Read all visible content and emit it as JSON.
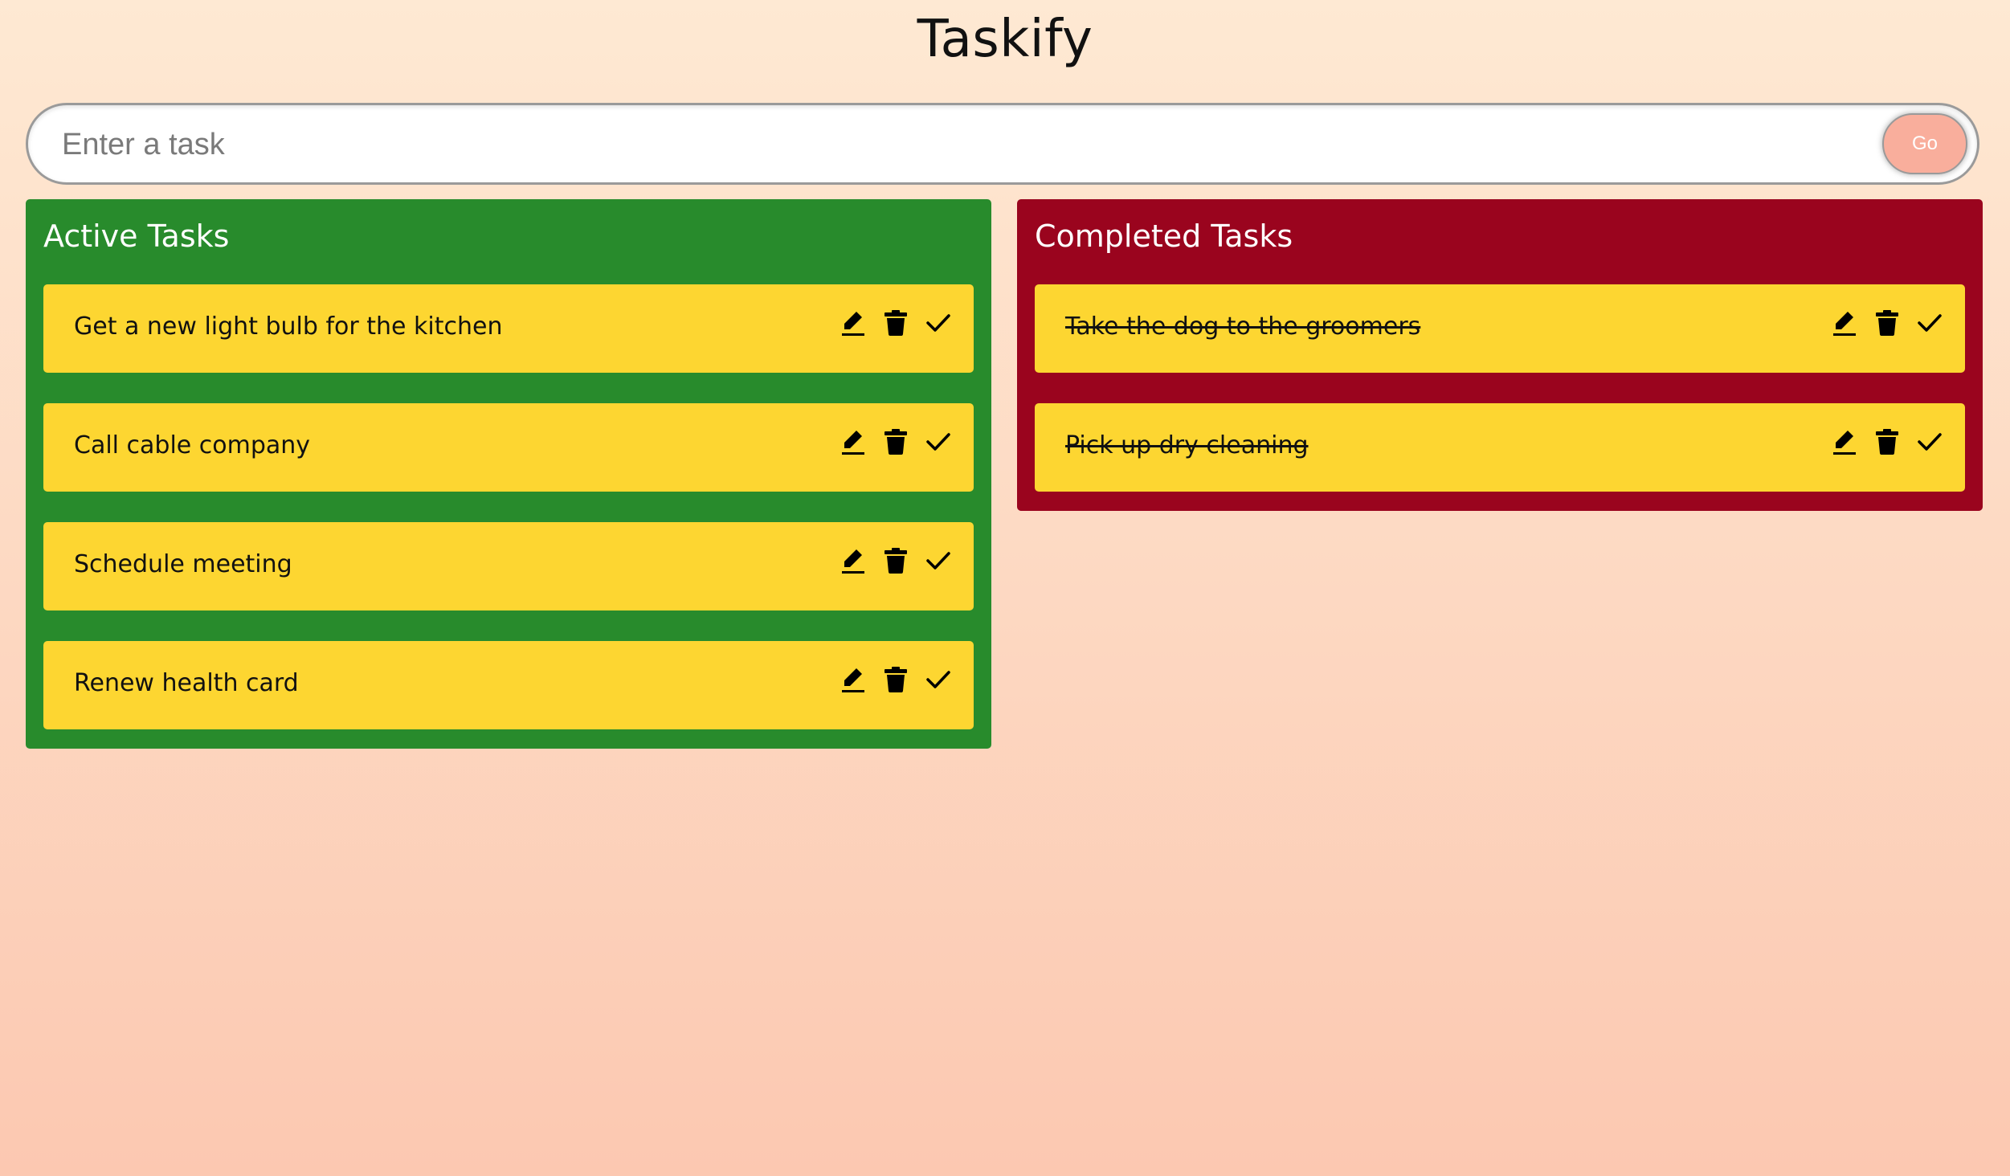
{
  "app": {
    "title": "Taskify"
  },
  "input": {
    "placeholder": "Enter a task",
    "value": "",
    "submit_label": "Go"
  },
  "active_panel": {
    "heading": "Active Tasks",
    "tasks": [
      "Get a new light bulb for the kitchen",
      "Call cable company",
      "Schedule meeting",
      "Renew health card"
    ]
  },
  "completed_panel": {
    "heading": "Completed Tasks",
    "tasks": [
      "Take the dog to the groomers",
      "Pick up dry cleaning"
    ]
  },
  "task_actions": [
    "pencil-icon",
    "trash-icon",
    "check-icon"
  ],
  "colors": {
    "active_panel": "#288b2c",
    "completed_panel": "#9a041e",
    "task_card": "#fdd631",
    "go_button": "#f9ae9c"
  }
}
